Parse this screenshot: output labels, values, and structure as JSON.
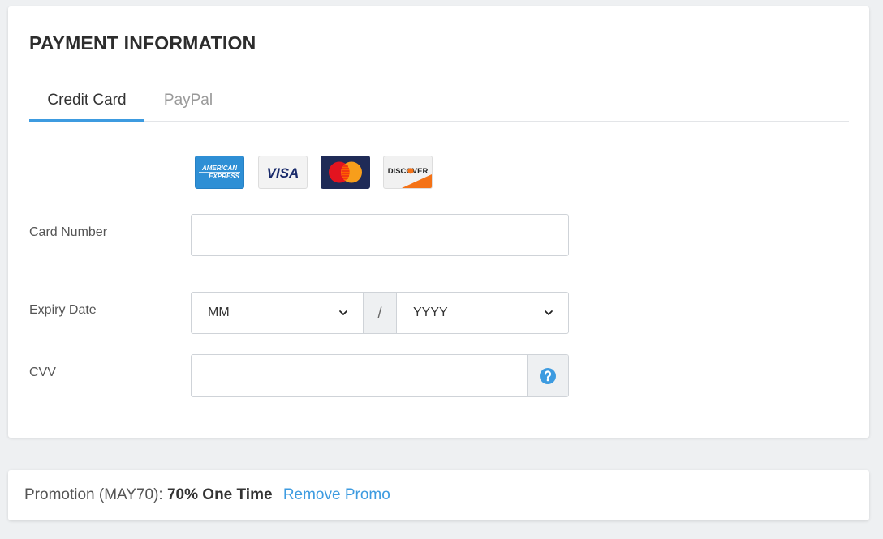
{
  "header": {
    "title": "PAYMENT INFORMATION"
  },
  "tabs": [
    {
      "label": "Credit Card",
      "active": true
    },
    {
      "label": "PayPal",
      "active": false
    }
  ],
  "card_logos": [
    {
      "name": "amex-logo",
      "text_line1": "AMERICAN",
      "text_line2": "EXPRESS"
    },
    {
      "name": "visa-logo",
      "text": "VISA"
    },
    {
      "name": "mastercard-logo"
    },
    {
      "name": "discover-logo",
      "text": "DISCOVER"
    }
  ],
  "form": {
    "card_number": {
      "label": "Card Number",
      "value": ""
    },
    "expiry": {
      "label": "Expiry Date",
      "month_value": "MM",
      "separator": "/",
      "year_value": "YYYY"
    },
    "cvv": {
      "label": "CVV",
      "value": "",
      "help_icon": "question-circle-icon"
    }
  },
  "promotion": {
    "prefix": "Promotion (MAY70):",
    "offer": "70% One Time",
    "remove_link": "Remove Promo"
  },
  "colors": {
    "accent": "#3d9be0",
    "background": "#eef0f2",
    "tab_underline": "#3d9be0"
  }
}
